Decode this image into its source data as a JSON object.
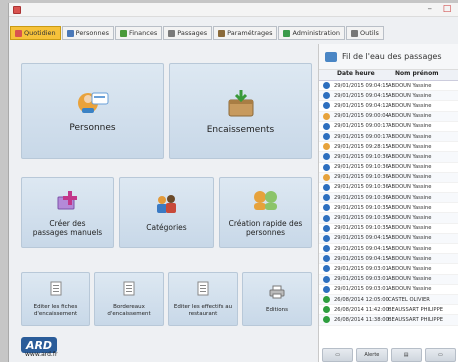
{
  "window": {
    "minimize": "–",
    "close": "□"
  },
  "tabs": [
    {
      "label": "Quotidien",
      "active": true,
      "icon": "calendar-icon",
      "color": "#d9534f"
    },
    {
      "label": "Personnes",
      "active": false,
      "icon": "person-icon",
      "color": "#4a78b8"
    },
    {
      "label": "Finances",
      "active": false,
      "icon": "money-icon",
      "color": "#4a9a3a"
    },
    {
      "label": "Passages",
      "active": false,
      "icon": "passage-icon",
      "color": "#7a7a7a"
    },
    {
      "label": "Paramétrages",
      "active": false,
      "icon": "settings-icon",
      "color": "#8a6a3a"
    },
    {
      "label": "Administration",
      "active": false,
      "icon": "admin-icon",
      "color": "#3a9a4a"
    },
    {
      "label": "Outils",
      "active": false,
      "icon": "tools-icon",
      "color": "#777777"
    }
  ],
  "main": {
    "personnes": "Personnes",
    "encaissements": "Encaissements",
    "creer_passages": "Créer des passages manuels",
    "categories": "Catégories",
    "creation_rapide": "Création rapide des personnes",
    "editer_fiches": "Editer les fiches d'encaissement",
    "bordereaux": "Bordereaux d'encaissement",
    "editer_effectifs": "Editer les effectifs au restaurant",
    "editions": "Editions"
  },
  "logo": {
    "text": "ARD",
    "url": "www.ard.fr"
  },
  "panel": {
    "title": "Fil de l'eau des passages",
    "col_date": "Date heure",
    "col_name": "Nom prénom",
    "rows": [
      {
        "date": "29/01/2015 09:04:15",
        "name": "ABDOUN Yassine",
        "kind": "in"
      },
      {
        "date": "29/01/2015 09:04:15",
        "name": "ABDOUN Yassine",
        "kind": "in"
      },
      {
        "date": "29/01/2015 09:04:12",
        "name": "ABDOUN Yassine",
        "kind": "in"
      },
      {
        "date": "29/01/2015 09:00:04",
        "name": "ABDOUN Yassine",
        "kind": "out"
      },
      {
        "date": "29/01/2015 09:00:17",
        "name": "ABDOUN Yassine",
        "kind": "in"
      },
      {
        "date": "29/01/2015 09:00:17",
        "name": "ABDOUN Yassine",
        "kind": "in"
      },
      {
        "date": "29/01/2015 09:28:15",
        "name": "ABDOUN Yassine",
        "kind": "out"
      },
      {
        "date": "29/01/2015 09:10:36",
        "name": "ABDOUN Yassine",
        "kind": "in"
      },
      {
        "date": "29/01/2015 09:10:36",
        "name": "ABDOUN Yassine",
        "kind": "in"
      },
      {
        "date": "29/01/2015 09:10:36",
        "name": "ABDOUN Yassine",
        "kind": "out"
      },
      {
        "date": "29/01/2015 09:10:36",
        "name": "ABDOUN Yassine",
        "kind": "in"
      },
      {
        "date": "29/01/2015 09:10:36",
        "name": "ABDOUN Yassine",
        "kind": "in"
      },
      {
        "date": "29/01/2015 09:10:35",
        "name": "ABDOUN Yassine",
        "kind": "in"
      },
      {
        "date": "29/01/2015 09:10:35",
        "name": "ABDOUN Yassine",
        "kind": "in"
      },
      {
        "date": "29/01/2015 09:10:35",
        "name": "ABDOUN Yassine",
        "kind": "in"
      },
      {
        "date": "29/01/2015 09:04:15",
        "name": "ABDOUN Yassine",
        "kind": "in"
      },
      {
        "date": "29/01/2015 09:04:15",
        "name": "ABDOUN Yassine",
        "kind": "in"
      },
      {
        "date": "29/01/2015 09:04:15",
        "name": "ABDOUN Yassine",
        "kind": "in"
      },
      {
        "date": "29/01/2015 09:03:01",
        "name": "ABDOUN Yassine",
        "kind": "in"
      },
      {
        "date": "29/01/2015 09:03:01",
        "name": "ABDOUN Yassine",
        "kind": "in"
      },
      {
        "date": "29/01/2015 09:03:01",
        "name": "ABDOUN Yassine",
        "kind": "in"
      },
      {
        "date": "26/08/2014 12:05:00",
        "name": "CASTEL OLIVIER",
        "kind": "ok"
      },
      {
        "date": "26/08/2014 11:42:00",
        "name": "BEAUSSART PHILIPPE",
        "kind": "ok"
      },
      {
        "date": "26/08/2014 11:38:00",
        "name": "BEAUSSART PHILIPPE",
        "kind": "ok"
      }
    ],
    "alerts": "Alerte"
  },
  "colors": {
    "accent": "#f6c23a",
    "tile": "#cddbe9",
    "brand": "#2a5c99"
  }
}
